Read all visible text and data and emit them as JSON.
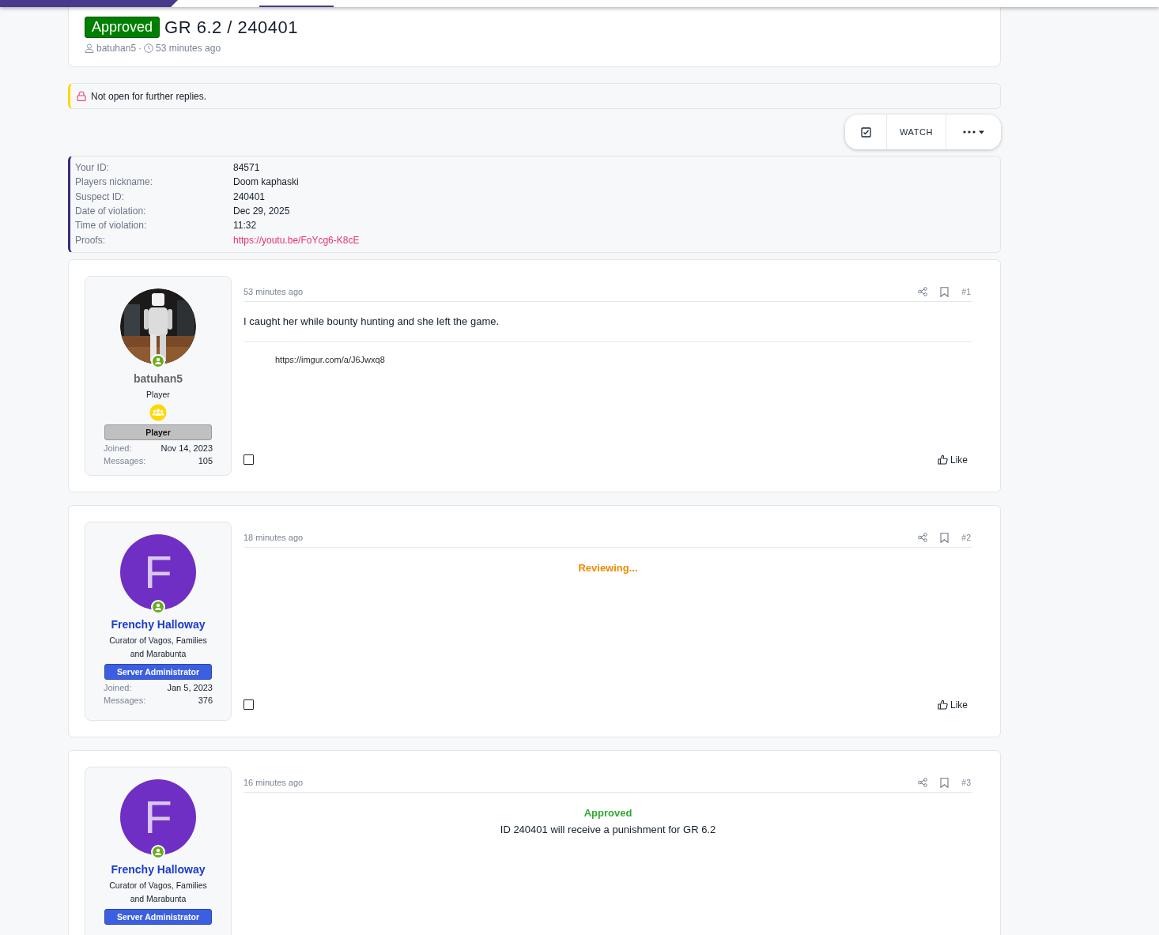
{
  "thread": {
    "prefix": "Approved",
    "title": "GR 6.2 / 240401",
    "author": "batuhan5",
    "separator": "·",
    "time": "53 minutes ago"
  },
  "notice": {
    "text": "Not open for further replies."
  },
  "actions": [
    {
      "kind": "checkbox"
    },
    {
      "kind": "watch",
      "label": "WATCH"
    },
    {
      "kind": "more"
    }
  ],
  "form": [
    {
      "label": "Your ID:",
      "value": "84571",
      "kind": "text"
    },
    {
      "label": "Players nickname:",
      "value": "Doom kaphaski",
      "kind": "text"
    },
    {
      "label": "Suspect ID:",
      "value": "240401",
      "kind": "text"
    },
    {
      "label": "Date of violation:",
      "value": "Dec 29, 2025",
      "kind": "text"
    },
    {
      "label": "Time of violation:",
      "value": "11:32",
      "kind": "text"
    },
    {
      "label": "Proofs:",
      "value": "https://youtu.be/FoYcg6-K8cE",
      "kind": "link"
    }
  ],
  "posts": [
    {
      "time": "53 minutes ago",
      "number": "#1",
      "user": {
        "name": "batuhan5",
        "online": true,
        "title": "Player",
        "kind": "player",
        "banner": "Player",
        "stats": [
          {
            "label": "Joined:",
            "value": "Nov 14, 2023"
          },
          {
            "label": "Messages:",
            "value": "105"
          }
        ]
      },
      "content": [
        {
          "kind": "paragraph",
          "text": "I caught her while bounty hunting and she left the game."
        },
        {
          "kind": "embed",
          "text": "https://imgur.com/a/J6Jwxq8"
        }
      ],
      "footer": {
        "checked": false,
        "like": "Like"
      }
    },
    {
      "time": "18 minutes ago",
      "number": "#2",
      "user": {
        "name": "Frenchy Halloway",
        "avatar": {
          "kind": "letter",
          "letter": "F"
        },
        "online": true,
        "title": "Curator of Vagos, Families and Marabunta",
        "kind": "admin",
        "banner": "Server Administrator",
        "stats": [
          {
            "label": "Joined:",
            "value": "Jan 5, 2023"
          },
          {
            "label": "Messages:",
            "value": "376"
          }
        ]
      },
      "content": [
        {
          "kind": "pending",
          "text": "Reviewing..."
        }
      ],
      "footer": {
        "checked": false,
        "like": "Like"
      }
    },
    {
      "time": "16 minutes ago",
      "number": "#3",
      "user": {
        "name": "Frenchy Halloway",
        "avatar": {
          "kind": "letter",
          "letter": "F"
        },
        "online": true,
        "title": "Curator of Vagos, Families and Marabunta",
        "kind": "admin",
        "banner": "Server Administrator"
      },
      "content": [
        {
          "kind": "approved",
          "text": "Approved"
        },
        {
          "kind": "center",
          "text": "ID 240401 will receive a punishment for GR 6.2"
        }
      ]
    }
  ]
}
